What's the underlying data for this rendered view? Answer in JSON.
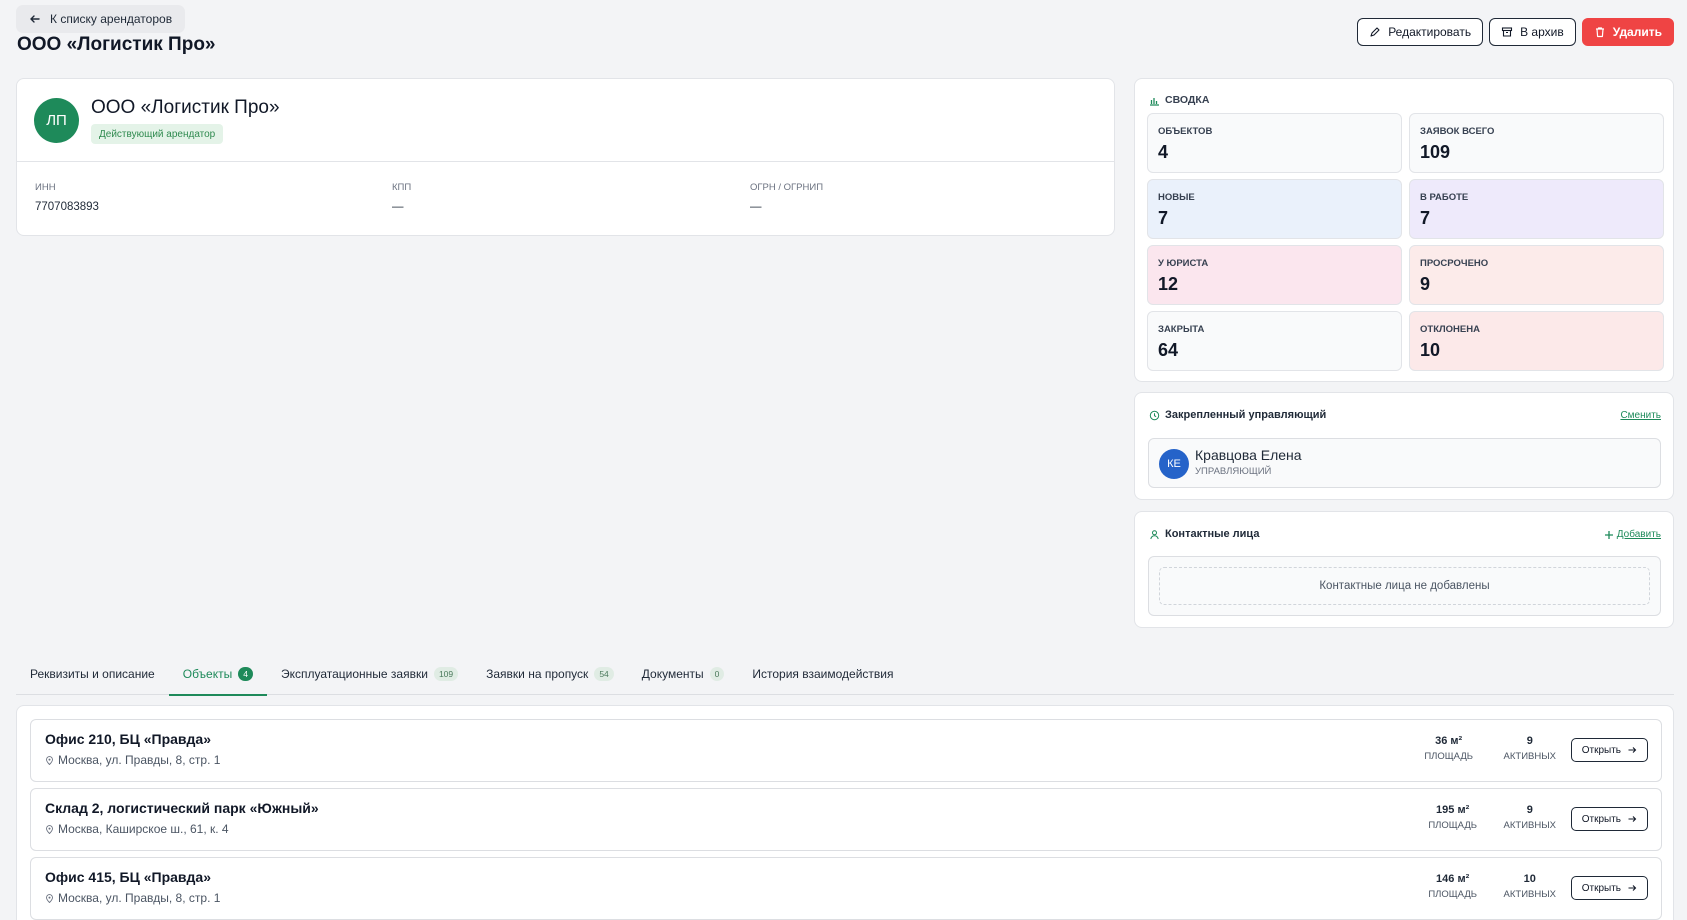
{
  "header": {
    "back_label": "К списку арендаторов",
    "page_title": "ООО «Логистик Про»",
    "actions": {
      "edit": "Редактировать",
      "archive": "В архив",
      "delete": "Удалить"
    }
  },
  "tenant": {
    "initials": "ЛП",
    "name": "ООО «Логистик Про»",
    "status": "Действующий арендатор",
    "fields": [
      {
        "label": "ИНН",
        "value": "7707083893"
      },
      {
        "label": "КПП",
        "value": "—"
      },
      {
        "label": "ОГРН / ОГРНИП",
        "value": "—"
      }
    ]
  },
  "summary": {
    "title": "СВОДКА",
    "stats": [
      {
        "label": "ОБЪЕКТОВ",
        "value": "4",
        "bg": "#f9fafb"
      },
      {
        "label": "ЗАЯВОК ВСЕГО",
        "value": "109",
        "bg": "#f9fafb"
      },
      {
        "label": "НОВЫЕ",
        "value": "7",
        "bg": "#eaf1fb"
      },
      {
        "label": "В РАБОТЕ",
        "value": "7",
        "bg": "#eeeafb"
      },
      {
        "label": "У ЮРИСТА",
        "value": "12",
        "bg": "#fbe6ee"
      },
      {
        "label": "ПРОСРОЧЕНО",
        "value": "9",
        "bg": "#fcebea"
      },
      {
        "label": "ЗАКРЫТА",
        "value": "64",
        "bg": "#f9fafb"
      },
      {
        "label": "ОТКЛОНЕНА",
        "value": "10",
        "bg": "#fce9e9"
      }
    ]
  },
  "manager": {
    "title": "Закрепленный управляющий",
    "change_label": "Сменить",
    "initials": "КЕ",
    "name": "Кравцова Елена",
    "role": "УПРАВЛЯЮЩИЙ"
  },
  "contacts": {
    "title": "Контактные лица",
    "add_label": "Добавить",
    "empty_text": "Контактные лица не добавлены"
  },
  "tabs": [
    {
      "label": "Реквизиты и описание",
      "count": null,
      "active": false
    },
    {
      "label": "Объекты",
      "count": "4",
      "active": true
    },
    {
      "label": "Эксплуатационные заявки",
      "count": "109",
      "active": false
    },
    {
      "label": "Заявки на пропуск",
      "count": "54",
      "active": false
    },
    {
      "label": "Документы",
      "count": "0",
      "active": false
    },
    {
      "label": "История взаимодействия",
      "count": null,
      "active": false
    }
  ],
  "objects": {
    "area_label": "ПЛОЩАДЬ",
    "active_label": "АКТИВНЫХ",
    "open_label": "Открыть",
    "items": [
      {
        "name": "Офис 210, БЦ «Правда»",
        "address": "Москва, ул. Правды, 8, стр. 1",
        "area": "36 м²",
        "active": "9"
      },
      {
        "name": "Склад 2, логистический парк «Южный»",
        "address": "Москва, Каширское ш., 61, к. 4",
        "area": "195 м²",
        "active": "9"
      },
      {
        "name": "Офис 415, БЦ «Правда»",
        "address": "Москва, ул. Правды, 8, стр. 1",
        "area": "146 м²",
        "active": "10"
      }
    ]
  },
  "colors": {
    "accent": "#1e8a5a",
    "danger": "#ef4444",
    "manager_avatar": "#2563c9"
  }
}
